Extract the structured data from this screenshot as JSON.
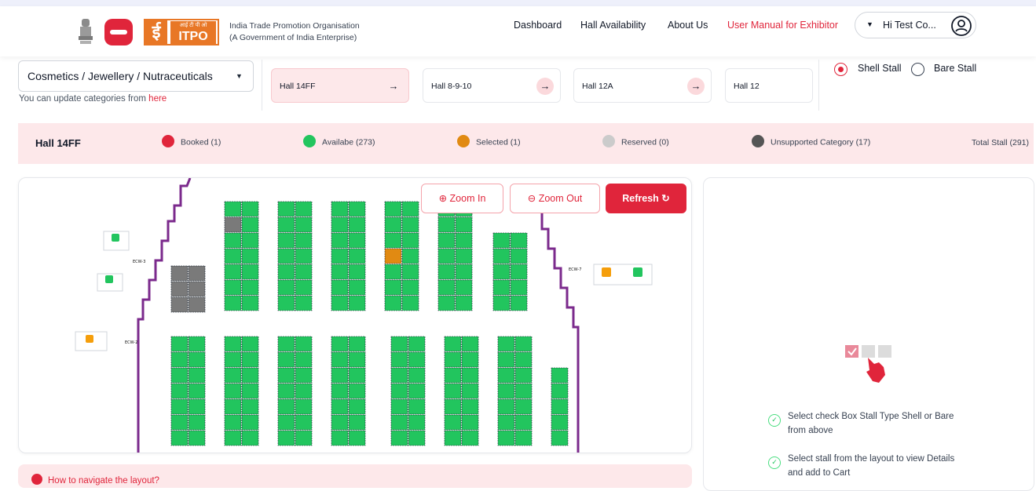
{
  "header": {
    "org_name": "India Trade Promotion Organisation",
    "org_sub": "(A Government of India Enterprise)",
    "logo_hindi": "आई टी पी ओ",
    "logo_text": "ITPO",
    "nav": [
      "Dashboard",
      "Hall Availability",
      "About Us",
      "User Manual for Exhibitor"
    ],
    "user_label": "Hi Test Co..."
  },
  "filters": {
    "category_value": "Cosmetics / Jewellery / Nutraceuticals",
    "category_hint_prefix": "You can update categories from",
    "category_hint_link": "here",
    "halls": [
      {
        "label": "Hall 14FF",
        "active": true
      },
      {
        "label": "Hall 8-9-10",
        "active": false
      },
      {
        "label": "Hall 12A",
        "active": false
      },
      {
        "label": "Hall 12",
        "active": false
      }
    ],
    "stall_types": [
      {
        "label": "Shell Stall",
        "checked": true
      },
      {
        "label": "Bare Stall",
        "checked": false
      }
    ]
  },
  "legend": {
    "hall_name": "Hall 14FF",
    "items": [
      {
        "label": "Booked (1)",
        "color": "#e0253b"
      },
      {
        "label": "Availabe (273)",
        "color": "#22c55e"
      },
      {
        "label": "Selected (1)",
        "color": "#e18a12"
      },
      {
        "label": "Reserved (0)",
        "color": "#cbcbcb"
      },
      {
        "label": "Unsupported Category (17)",
        "color": "#555555"
      }
    ],
    "total": "Total Stall (291)"
  },
  "map": {
    "zoom_in": "Zoom In",
    "zoom_out": "Zoom Out",
    "refresh": "Refresh",
    "labels": [
      "ECW-3",
      "ECW-2",
      "ECW-7"
    ]
  },
  "side_panel": {
    "hints": [
      "Select check Box Stall Type Shell or Bare from above",
      "Select stall from the layout to view Details and add to Cart"
    ]
  },
  "help": {
    "how_to": "How to navigate the layout?"
  },
  "colors": {
    "accent": "#e0253b",
    "available": "#22c55e",
    "boundary": "#7b2a8c"
  }
}
